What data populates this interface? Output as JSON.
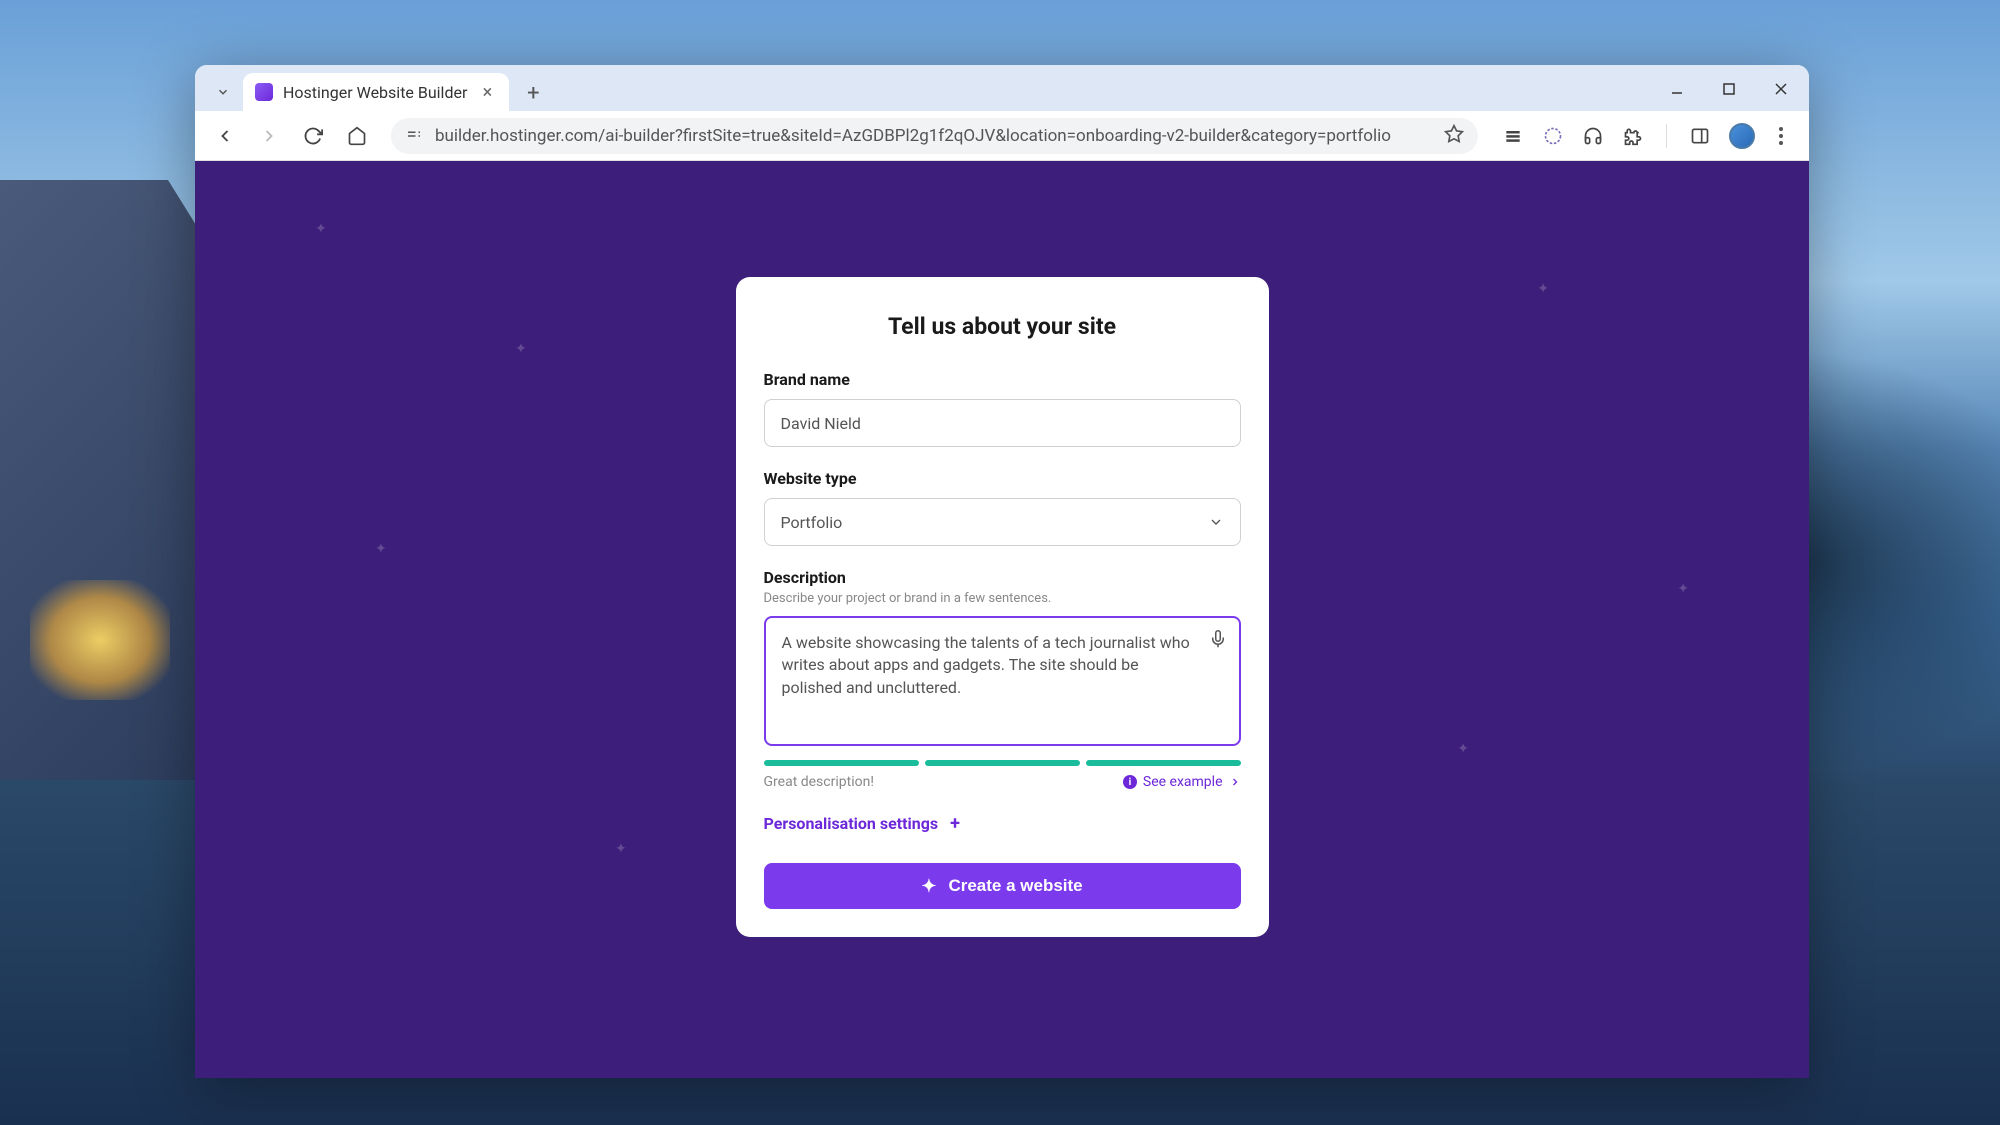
{
  "browser": {
    "tab_title": "Hostinger Website Builder",
    "url": "builder.hostinger.com/ai-builder?firstSite=true&siteId=AzGDBPl2g1f2qOJV&location=onboarding-v2-builder&category=portfolio"
  },
  "modal": {
    "title": "Tell us about your site",
    "brand": {
      "label": "Brand name",
      "value": "David Nield"
    },
    "type": {
      "label": "Website type",
      "value": "Portfolio"
    },
    "description": {
      "label": "Description",
      "sublabel": "Describe your project or brand in a few sentences.",
      "value": "A website showcasing the talents of a tech journalist who writes about apps and gadgets. The site should be polished and uncluttered."
    },
    "quality": "Great description!",
    "example_link": "See example",
    "personalisation": "Personalisation settings",
    "create_button": "Create a website"
  }
}
